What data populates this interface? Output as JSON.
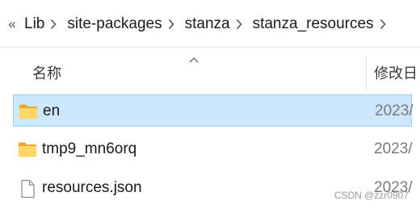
{
  "breadcrumb": {
    "overflow_glyph": "«",
    "items": [
      "Lib",
      "site-packages",
      "stanza",
      "stanza_resources"
    ]
  },
  "columns": {
    "name": "名称",
    "modified": "修改日"
  },
  "files": [
    {
      "name": "en",
      "type": "folder",
      "modified": "2023/",
      "selected": true
    },
    {
      "name": "tmp9_mn6orq",
      "type": "folder",
      "modified": "2023/",
      "selected": false
    },
    {
      "name": "resources.json",
      "type": "file",
      "modified": "2023/",
      "selected": false
    }
  ],
  "watermark": "CSDN @zzr0907",
  "colors": {
    "selection_bg": "#cce8ff",
    "selection_border": "#99d1ff",
    "folder_yellow": "#ffd766"
  }
}
